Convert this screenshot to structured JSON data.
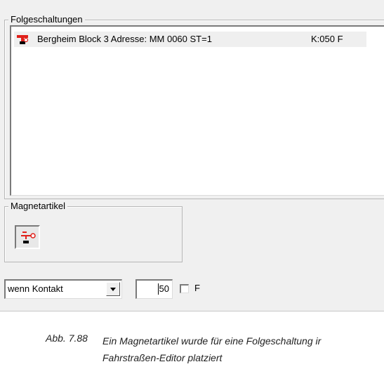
{
  "folgeschaltungen": {
    "title": "Folgeschaltungen",
    "items": [
      {
        "icon": "magnet-article-icon",
        "text": "Bergheim Block 3 Adresse: MM 0060 ST=1",
        "k": "K:050 F"
      }
    ]
  },
  "magnetartikel": {
    "title": "Magnetartikel",
    "button_icon": "magnet-article-icon"
  },
  "condition": {
    "selected": "wenn Kontakt",
    "value": "50",
    "checkbox_label": "F",
    "checkbox_checked": false
  },
  "caption": {
    "label": "Abb. 7.88",
    "line1": "Ein Magnetartikel wurde für eine Folgeschaltung ir",
    "line2": "Fahrstraßen-Editor platziert"
  },
  "colors": {
    "dialog_bg": "#f0f0f0",
    "list_bg": "#ffffff",
    "icon_red": "#e0201a"
  }
}
